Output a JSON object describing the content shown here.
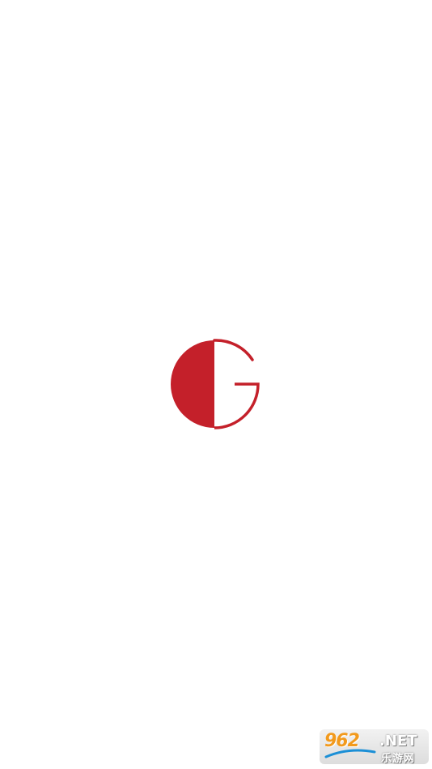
{
  "app": {
    "screen": "splash",
    "brand_color": "#c4202a",
    "background_color": "#ffffff"
  },
  "logo": {
    "icon": "g-logo-icon"
  },
  "watermark": {
    "number": "962",
    "net": ".NET",
    "site_name": "乐游网",
    "number_color": "#f29a1d"
  }
}
